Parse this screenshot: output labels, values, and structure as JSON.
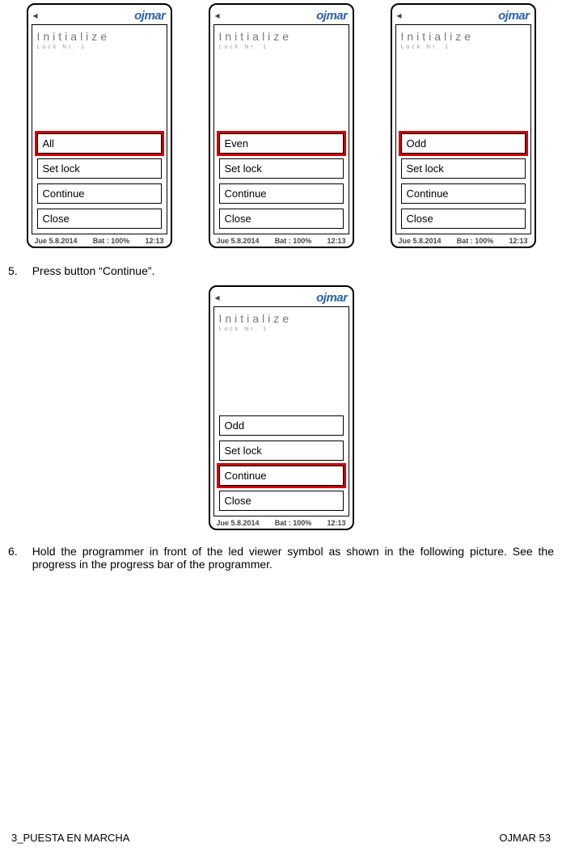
{
  "brand": "ojmar",
  "screen_title": "Initialize",
  "screen_sub": "Lock Nr. 1",
  "buttons_common": {
    "set_lock": "Set lock",
    "continue": "Continue",
    "close": "Close"
  },
  "first_labels": {
    "all": "All",
    "even": "Even",
    "odd": "Odd"
  },
  "status": {
    "date": "Jue 5.8.2014",
    "bat": "Bat :  100%",
    "time": "12:13"
  },
  "step5": {
    "num": "5.",
    "text": "Press button “Continue”."
  },
  "step6": {
    "num": "6.",
    "text": "Hold the programmer in front of the led viewer symbol as shown in the following picture. See the progress in the progress bar of the programmer."
  },
  "footer": {
    "left": "3_PUESTA EN MARCHA",
    "right": "OJMAR 53"
  }
}
